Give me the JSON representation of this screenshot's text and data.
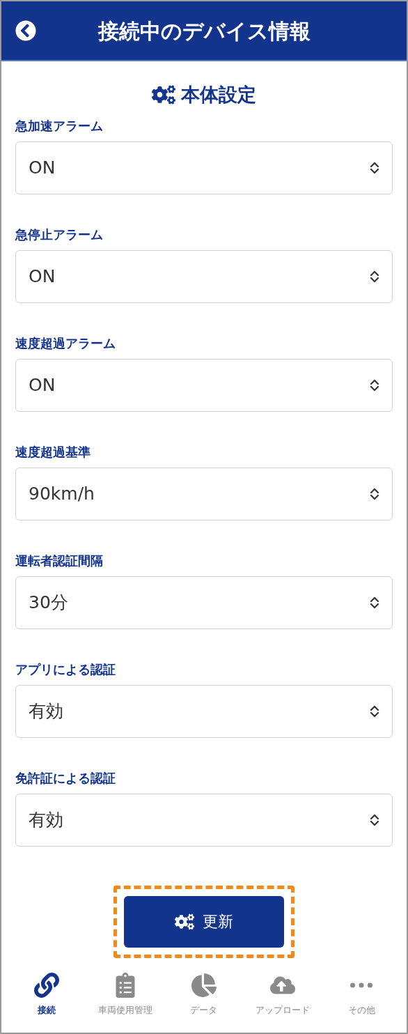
{
  "header": {
    "title": "接続中のデバイス情報"
  },
  "section": {
    "title": "本体設定"
  },
  "fields": [
    {
      "label": "急加速アラーム",
      "value": "ON"
    },
    {
      "label": "急停止アラーム",
      "value": "ON"
    },
    {
      "label": "速度超過アラーム",
      "value": "ON"
    },
    {
      "label": "速度超過基準",
      "value": "90km/h"
    },
    {
      "label": "運転者認証間隔",
      "value": "30分"
    },
    {
      "label": "アプリによる認証",
      "value": "有効"
    },
    {
      "label": "免許証による認証",
      "value": "有効"
    }
  ],
  "update_button": {
    "label": "更新",
    "highlighted": true
  },
  "tab_bar": [
    {
      "label": "接続",
      "kind": "link",
      "selected": true
    },
    {
      "label": "車両使用管理",
      "kind": "clipboard",
      "selected": false
    },
    {
      "label": "データ",
      "kind": "pie",
      "selected": false
    },
    {
      "label": "アップロード",
      "kind": "cloud",
      "selected": false
    },
    {
      "label": "その他",
      "kind": "dots",
      "selected": false
    }
  ]
}
